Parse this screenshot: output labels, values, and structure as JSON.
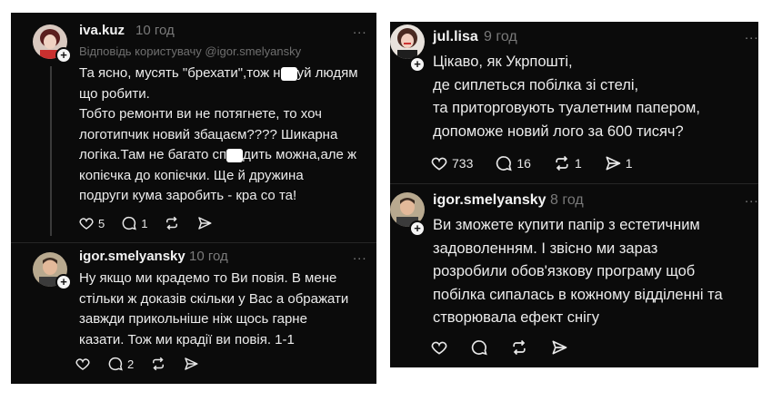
{
  "left": {
    "post1": {
      "username": "iva.kuz",
      "time": "10 год",
      "reply_to": "Відповідь користувачу @igor.smelyansky",
      "lines": [
        [
          "Та ясно, мусять \"брехати\",тож н",
          "#redact",
          "уй людям"
        ],
        [
          "що робити."
        ],
        [
          "Тобто ремонти ви не потягнете, то хоч"
        ],
        [
          "логотипчик новий збацаєм???? Шикарна"
        ],
        [
          "логіка.Там не багато сп",
          "#redact",
          "дить можна,але ж"
        ],
        [
          "копієчка до копієчки. Ще й дружина"
        ],
        [
          "подруги кума заробить - кра со та!"
        ]
      ],
      "likes": "5",
      "replies": "1"
    },
    "post2": {
      "username": "igor.smelyansky",
      "time": "10 год",
      "lines": [
        "Ну якщо ми крадемо то Ви повія. В мене",
        "стільки ж доказів скільки у Вас а ображати",
        "завжди прикольніше ніж щось гарне",
        "казати. Тож ми крадії ви повія. 1-1"
      ],
      "replies": "2"
    }
  },
  "right": {
    "post1": {
      "username": "jul.lisa",
      "time": "9 год",
      "lines": [
        "Цікаво, як Укрпошті,",
        "де сиплеться побілка зі стелі,",
        "та приторговують туалетним папером,",
        "допоможе новий лого за 600 тисяч?"
      ],
      "likes": "733",
      "replies": "16",
      "reposts": "1",
      "shares": "1"
    },
    "post2": {
      "username": "igor.smelyansky",
      "time": "8 год",
      "lines": [
        "Ви зможете купити папір з естетичним",
        "задоволенням. І звісно ми зараз",
        "розробили обов'язкову програму щоб",
        "побілка сипалась в кожному відділенні та",
        "створювала ефект снігу"
      ]
    }
  },
  "more_glyph": "...",
  "plus_glyph": "+"
}
